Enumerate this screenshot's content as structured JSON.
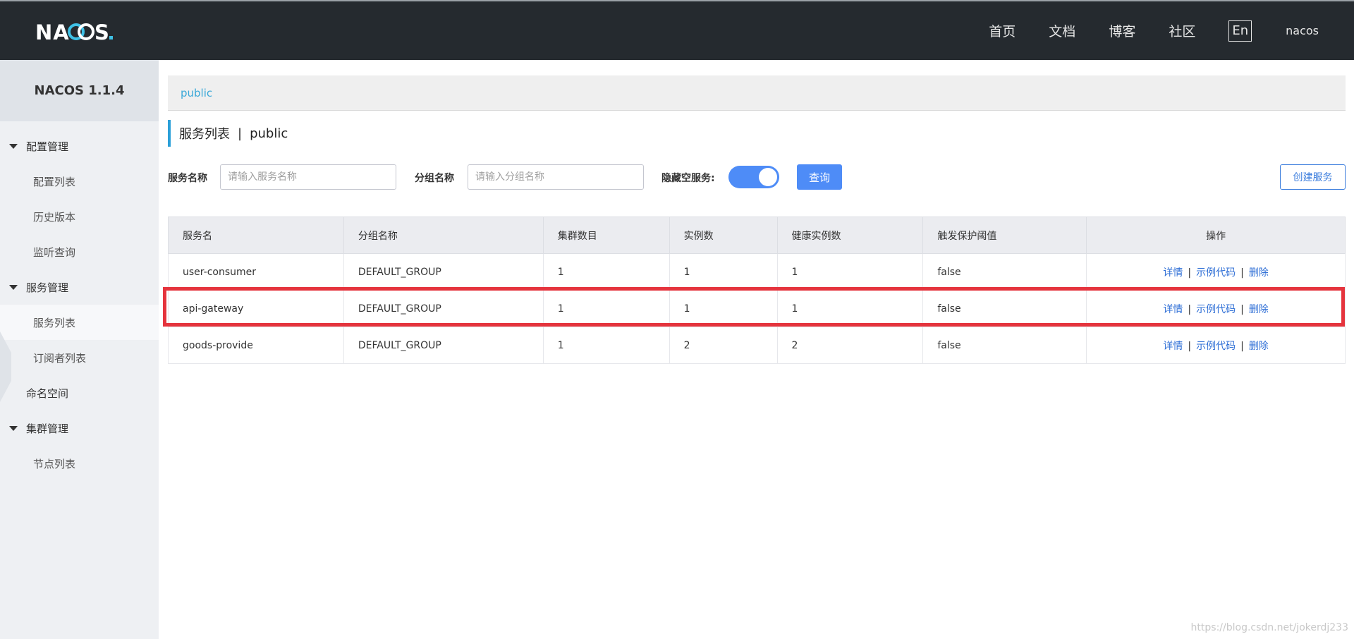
{
  "header": {
    "logo": "NACOS.",
    "nav": [
      "首页",
      "文档",
      "博客",
      "社区"
    ],
    "lang": "En",
    "user": "nacos"
  },
  "sidebar": {
    "version": "NACOS 1.1.4",
    "items": [
      {
        "label": "配置管理",
        "type": "group"
      },
      {
        "label": "配置列表",
        "type": "sub"
      },
      {
        "label": "历史版本",
        "type": "sub"
      },
      {
        "label": "监听查询",
        "type": "sub"
      },
      {
        "label": "服务管理",
        "type": "group"
      },
      {
        "label": "服务列表",
        "type": "sub",
        "active": true
      },
      {
        "label": "订阅者列表",
        "type": "sub"
      },
      {
        "label": "命名空间",
        "type": "top"
      },
      {
        "label": "集群管理",
        "type": "group"
      },
      {
        "label": "节点列表",
        "type": "sub"
      }
    ]
  },
  "namespace": {
    "current": "public"
  },
  "page": {
    "title": "服务列表",
    "sep": "|",
    "namespace": "public"
  },
  "filters": {
    "service_name_label": "服务名称",
    "service_name_placeholder": "请输入服务名称",
    "group_name_label": "分组名称",
    "group_name_placeholder": "请输入分组名称",
    "hide_empty_label": "隐藏空服务:",
    "hide_empty_on": true,
    "query_label": "查询",
    "create_label": "创建服务"
  },
  "table": {
    "columns": [
      "服务名",
      "分组名称",
      "集群数目",
      "实例数",
      "健康实例数",
      "触发保护阈值",
      "操作"
    ],
    "rows": [
      {
        "name": "user-consumer",
        "group": "DEFAULT_GROUP",
        "clusters": "1",
        "instances": "1",
        "healthy": "1",
        "threshold": "false"
      },
      {
        "name": "api-gateway",
        "group": "DEFAULT_GROUP",
        "clusters": "1",
        "instances": "1",
        "healthy": "1",
        "threshold": "false"
      },
      {
        "name": "goods-provide",
        "group": "DEFAULT_GROUP",
        "clusters": "1",
        "instances": "2",
        "healthy": "2",
        "threshold": "false"
      }
    ],
    "actions": {
      "detail": "详情",
      "sample": "示例代码",
      "delete": "删除",
      "sep": "|"
    }
  },
  "watermark": "https://blog.csdn.net/jokerdj233"
}
